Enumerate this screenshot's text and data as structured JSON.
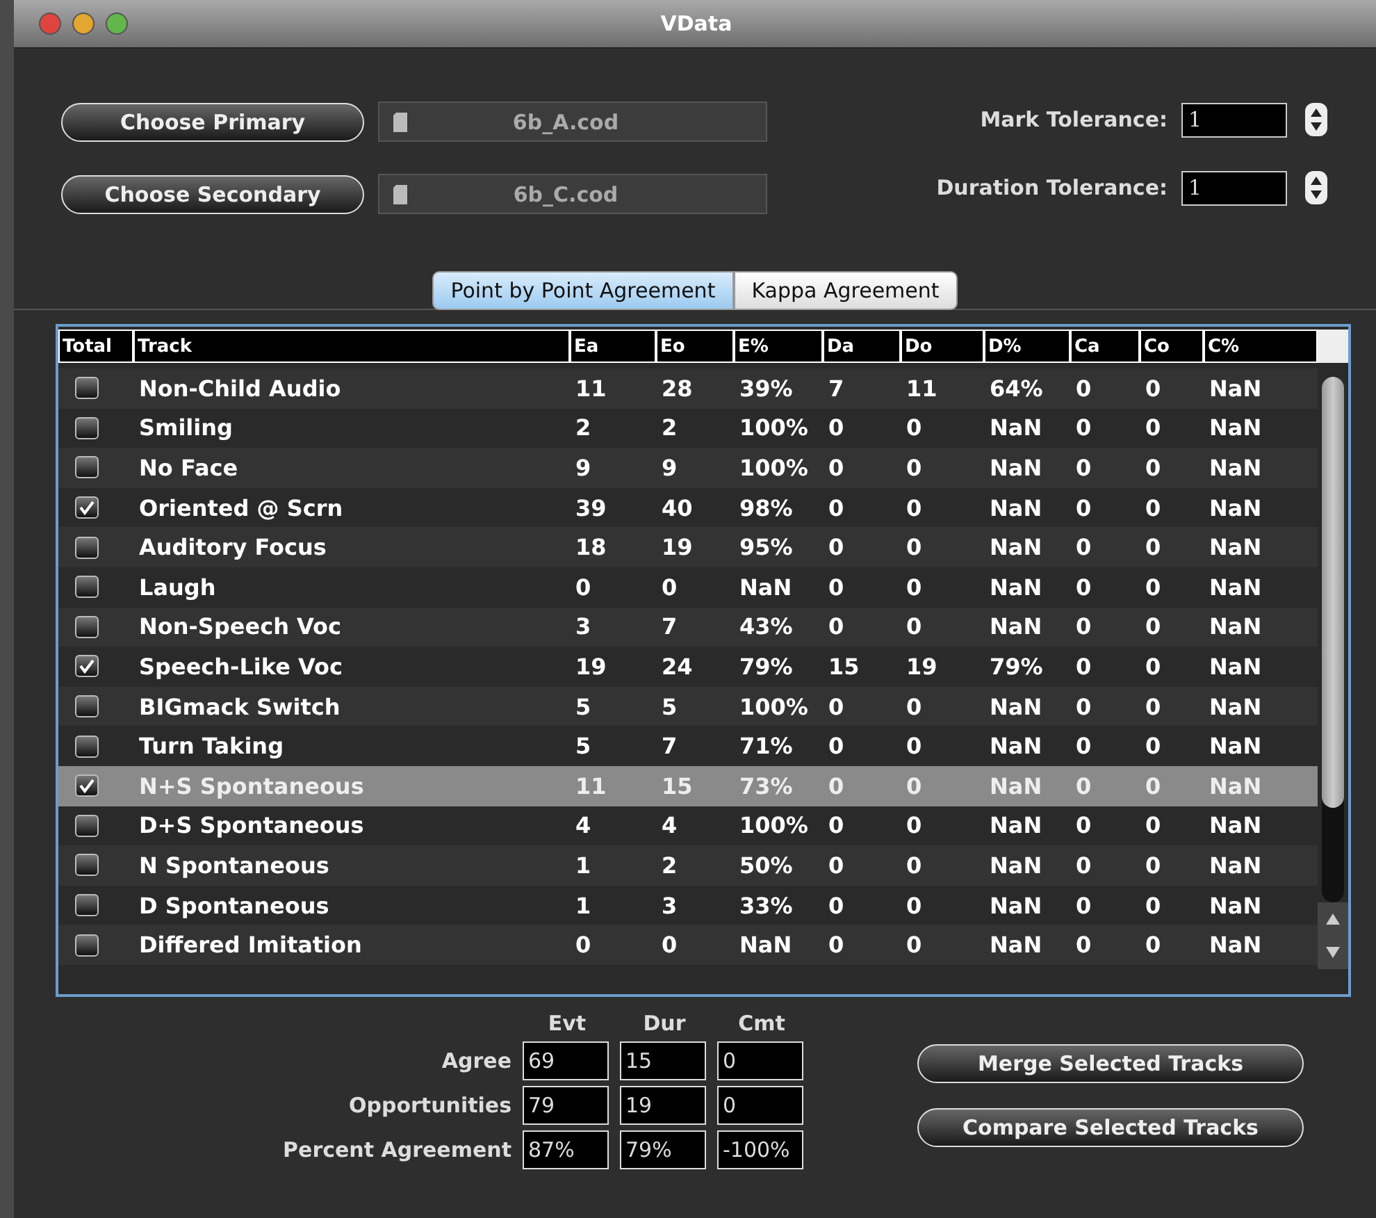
{
  "window": {
    "title": "VData"
  },
  "files": [
    {
      "button": "Choose Primary",
      "file": "6b_A.cod"
    },
    {
      "button": "Choose Secondary",
      "file": "6b_C.cod"
    }
  ],
  "tolerances": [
    {
      "label": "Mark Tolerance:",
      "value": "1"
    },
    {
      "label": "Duration Tolerance:",
      "value": "1"
    }
  ],
  "tabs": [
    {
      "label": "Point by Point Agreement",
      "selected": true
    },
    {
      "label": "Kappa Agreement",
      "selected": false
    }
  ],
  "table": {
    "columns": [
      "Total",
      "Track",
      "Ea",
      "Eo",
      "E%",
      "Da",
      "Do",
      "D%",
      "Ca",
      "Co",
      "C%"
    ],
    "rows": [
      {
        "checked": false,
        "selected": false,
        "cells": [
          "",
          "Non-Child Audio",
          "11",
          "28",
          "39%",
          "7",
          "11",
          "64%",
          "0",
          "0",
          "NaN"
        ]
      },
      {
        "checked": false,
        "selected": false,
        "cells": [
          "",
          "Smiling",
          "2",
          "2",
          "100%",
          "0",
          "0",
          "NaN",
          "0",
          "0",
          "NaN"
        ]
      },
      {
        "checked": false,
        "selected": false,
        "cells": [
          "",
          "No Face",
          "9",
          "9",
          "100%",
          "0",
          "0",
          "NaN",
          "0",
          "0",
          "NaN"
        ]
      },
      {
        "checked": true,
        "selected": false,
        "cells": [
          "",
          "Oriented @ Scrn",
          "39",
          "40",
          "98%",
          "0",
          "0",
          "NaN",
          "0",
          "0",
          "NaN"
        ]
      },
      {
        "checked": false,
        "selected": false,
        "cells": [
          "",
          "Auditory Focus",
          "18",
          "19",
          "95%",
          "0",
          "0",
          "NaN",
          "0",
          "0",
          "NaN"
        ]
      },
      {
        "checked": false,
        "selected": false,
        "cells": [
          "",
          "Laugh",
          "0",
          "0",
          "NaN",
          "0",
          "0",
          "NaN",
          "0",
          "0",
          "NaN"
        ]
      },
      {
        "checked": false,
        "selected": false,
        "cells": [
          "",
          "Non-Speech Voc",
          "3",
          "7",
          "43%",
          "0",
          "0",
          "NaN",
          "0",
          "0",
          "NaN"
        ]
      },
      {
        "checked": true,
        "selected": false,
        "cells": [
          "",
          "Speech-Like Voc",
          "19",
          "24",
          "79%",
          "15",
          "19",
          "79%",
          "0",
          "0",
          "NaN"
        ]
      },
      {
        "checked": false,
        "selected": false,
        "cells": [
          "",
          "BIGmack Switch",
          "5",
          "5",
          "100%",
          "0",
          "0",
          "NaN",
          "0",
          "0",
          "NaN"
        ]
      },
      {
        "checked": false,
        "selected": false,
        "cells": [
          "",
          "Turn Taking",
          "5",
          "7",
          "71%",
          "0",
          "0",
          "NaN",
          "0",
          "0",
          "NaN"
        ]
      },
      {
        "checked": true,
        "selected": true,
        "cells": [
          "",
          "N+S Spontaneous",
          "11",
          "15",
          "73%",
          "0",
          "0",
          "NaN",
          "0",
          "0",
          "NaN"
        ]
      },
      {
        "checked": false,
        "selected": false,
        "cells": [
          "",
          "D+S Spontaneous",
          "4",
          "4",
          "100%",
          "0",
          "0",
          "NaN",
          "0",
          "0",
          "NaN"
        ]
      },
      {
        "checked": false,
        "selected": false,
        "cells": [
          "",
          "N Spontaneous",
          "1",
          "2",
          "50%",
          "0",
          "0",
          "NaN",
          "0",
          "0",
          "NaN"
        ]
      },
      {
        "checked": false,
        "selected": false,
        "cells": [
          "",
          "D Spontaneous",
          "1",
          "3",
          "33%",
          "0",
          "0",
          "NaN",
          "0",
          "0",
          "NaN"
        ]
      },
      {
        "checked": false,
        "selected": false,
        "cells": [
          "",
          "Differed Imitation",
          "0",
          "0",
          "NaN",
          "0",
          "0",
          "NaN",
          "0",
          "0",
          "NaN"
        ]
      }
    ]
  },
  "summary": {
    "columns": [
      "Evt",
      "Dur",
      "Cmt"
    ],
    "rows": [
      {
        "label": "Agree",
        "values": [
          "69",
          "15",
          "0"
        ]
      },
      {
        "label": "Opportunities",
        "values": [
          "79",
          "19",
          "0"
        ]
      },
      {
        "label": "Percent Agreement",
        "values": [
          "87%",
          "79%",
          "-100%"
        ]
      }
    ]
  },
  "actions": [
    "Merge Selected Tracks",
    "Compare Selected Tracks"
  ]
}
